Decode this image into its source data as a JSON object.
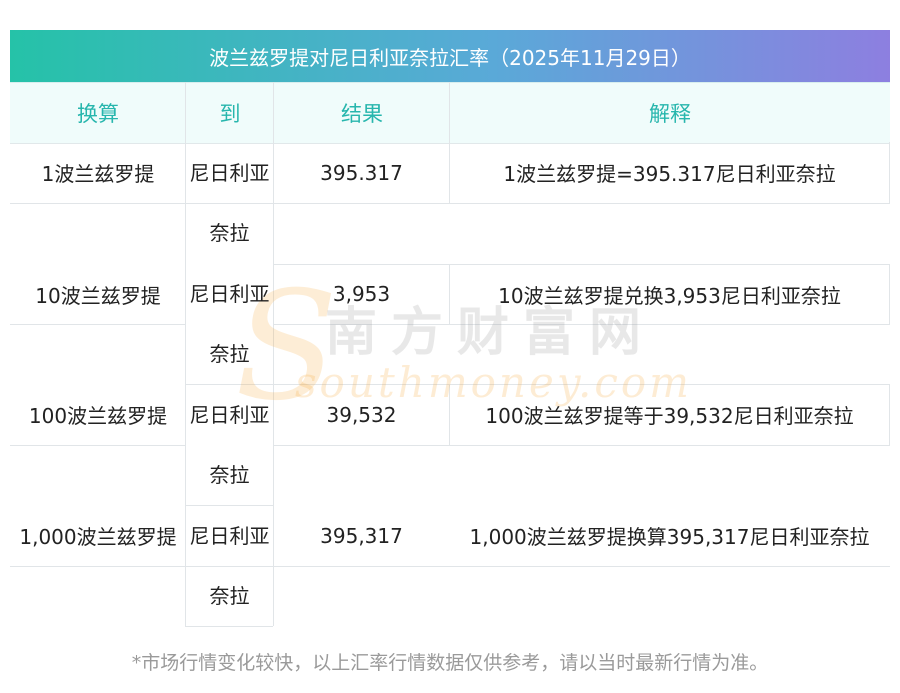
{
  "title": "波兰兹罗提对尼日利亚奈拉汇率（2025年11月29日）",
  "headers": [
    "换算",
    "到",
    "结果",
    "解释"
  ],
  "rows": [
    {
      "amount": "1波兰兹罗提",
      "to": "尼日利亚奈拉",
      "result": "395.317",
      "explain": "1波兰兹罗提=395.317尼日利亚奈拉"
    },
    {
      "amount": "10波兰兹罗提",
      "to": "尼日利亚奈拉",
      "result": "3,953",
      "explain": "10波兰兹罗提兑换3,953尼日利亚奈拉"
    },
    {
      "amount": "100波兰兹罗提",
      "to": "尼日利亚奈拉",
      "result": "39,532",
      "explain": "100波兰兹罗提等于39,532尼日利亚奈拉"
    },
    {
      "amount": "1,000波兰兹罗提",
      "to": "尼日利亚奈拉",
      "result": "395,317",
      "explain": "1,000波兰兹罗提换算395,317尼日利亚奈拉"
    }
  ],
  "watermark": {
    "cn": "南方财富网",
    "en": "southmoney.com"
  },
  "footnote": "*市场行情变化较快，以上汇率行情数据仅供参考，请以当时最新行情为准。"
}
